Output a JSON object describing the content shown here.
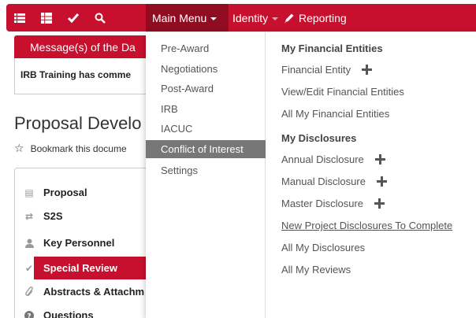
{
  "navbar": {
    "icons": [
      "list-icon",
      "grid-icon",
      "check-icon",
      "search-icon"
    ],
    "main_menu_label": "Main Menu",
    "identity_label": "Identity",
    "reporting_label": "Reporting",
    "colors": {
      "navbar_bg": "#c7102e",
      "main_menu_active_bg": "#8f0c21"
    }
  },
  "motd": {
    "title": "Message(s) of the Da",
    "text": "IRB Training has comme"
  },
  "document": {
    "title": "Proposal Develo",
    "bookmark_label": "Bookmark this docume"
  },
  "left_nav": {
    "items": [
      {
        "label": "Proposal",
        "icon": "document-icon",
        "active": false
      },
      {
        "label": "S2S",
        "icon": "transfer-icon",
        "active": false
      },
      {
        "label": "Key Personnel",
        "icon": "user-icon",
        "active": false
      },
      {
        "label": "Special Review",
        "icon": "check-icon",
        "active": true
      },
      {
        "label": "Abstracts & Attachm",
        "icon": "paperclip-icon",
        "active": false
      },
      {
        "label": "Questions",
        "icon": "question-icon",
        "active": false
      }
    ]
  },
  "dropdown": {
    "main_items": [
      {
        "label": "Pre-Award",
        "active": false
      },
      {
        "label": "Negotiations",
        "active": false
      },
      {
        "label": "Post-Award",
        "active": false
      },
      {
        "label": "IRB",
        "active": false
      },
      {
        "label": "IACUC",
        "active": false
      },
      {
        "label": "Conflict of Interest",
        "active": true
      },
      {
        "label": "Settings",
        "active": false
      }
    ],
    "section1_title": "My Financial Entities",
    "section1_links": [
      {
        "label": "Financial Entity",
        "plus": true
      },
      {
        "label": "View/Edit Financial Entities",
        "plus": false
      },
      {
        "label": "All My Financial Entities",
        "plus": false
      }
    ],
    "section2_title": "My Disclosures",
    "section2_links": [
      {
        "label": "Annual Disclosure",
        "plus": true
      },
      {
        "label": "Manual Disclosure",
        "plus": true
      },
      {
        "label": "Master Disclosure",
        "plus": true
      },
      {
        "label": "New Project Disclosures To Complete",
        "plus": false
      },
      {
        "label": "All My Disclosures",
        "plus": false
      },
      {
        "label": "All My Reviews",
        "plus": false
      }
    ]
  }
}
